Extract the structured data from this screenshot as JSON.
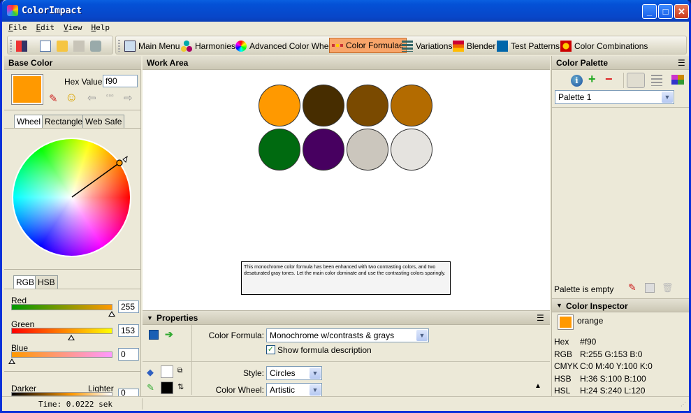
{
  "window": {
    "title": "ColorImpact"
  },
  "menu": [
    "File",
    "Edit",
    "View",
    "Help"
  ],
  "toolbar": {
    "items": [
      {
        "label": "Main Menu",
        "icon": "book-icon"
      },
      {
        "label": "Harmonies",
        "icon": "harmonies-icon"
      },
      {
        "label": "Advanced Color Wheel",
        "icon": "color-wheel-icon"
      },
      {
        "label": "Color Formulae",
        "icon": "formulae-icon",
        "active": true
      },
      {
        "label": "Variations",
        "icon": "variations-icon"
      },
      {
        "label": "Blender",
        "icon": "blender-icon"
      },
      {
        "label": "Test Patterns",
        "icon": "test-patterns-icon"
      },
      {
        "label": "Color Combinations",
        "icon": "color-combinations-icon"
      }
    ]
  },
  "base_color": {
    "header": "Base Color",
    "hex_label": "Hex Value:",
    "hex_value": "f90",
    "color": "#ff9900",
    "tabs": [
      "Wheel",
      "Rectangle",
      "Web Safe"
    ],
    "selected_tab": "Wheel",
    "model_tabs": [
      "RGB",
      "HSB"
    ],
    "selected_model": "RGB",
    "sliders": [
      {
        "label": "Red",
        "value": "255",
        "fraction": 1.0
      },
      {
        "label": "Green",
        "value": "153",
        "fraction": 0.6
      },
      {
        "label": "Blue",
        "value": "0",
        "fraction": 0.0
      }
    ],
    "darker_label": "Darker",
    "lighter_label": "Lighter",
    "brightness_value": "0"
  },
  "work_area": {
    "header": "Work Area",
    "swatches": [
      "#ff9900",
      "#472d00",
      "#7a4a00",
      "#b36b00",
      "#006a10",
      "#470060",
      "#cbc6bd",
      "#e5e3df"
    ],
    "description": "This monochrome color formula has been enhanced with two contrasting colors, and two desaturated gray tones. Let the main color dominate and use the contrasting colors sparingly."
  },
  "properties": {
    "header": "Properties",
    "formula_label": "Color Formula:",
    "formula_value": "Monochrome w/contrasts & grays",
    "show_desc_label": "Show formula description",
    "show_desc_checked": true,
    "style_label": "Style:",
    "style_value": "Circles",
    "wheel_label": "Color Wheel:",
    "wheel_value": "Artistic",
    "fill_color": "#ffffff",
    "stroke_color": "#000000"
  },
  "palette": {
    "header": "Color Palette",
    "selected": "Palette 1",
    "empty_text": "Palette is empty"
  },
  "inspector": {
    "header": "Color Inspector",
    "name": "orange",
    "color": "#ff9900",
    "rows": [
      {
        "k": "Hex",
        "v": "#f90"
      },
      {
        "k": "RGB",
        "v": "R:255  G:153  B:0"
      },
      {
        "k": "CMYK",
        "v": "C:0  M:40  Y:100  K:0"
      },
      {
        "k": "HSB",
        "v": "H:36  S:100  B:100"
      },
      {
        "k": "HSL",
        "v": "H:24  S:240  L:120"
      }
    ]
  },
  "status": {
    "time": "Time: 0.0222 sek"
  }
}
